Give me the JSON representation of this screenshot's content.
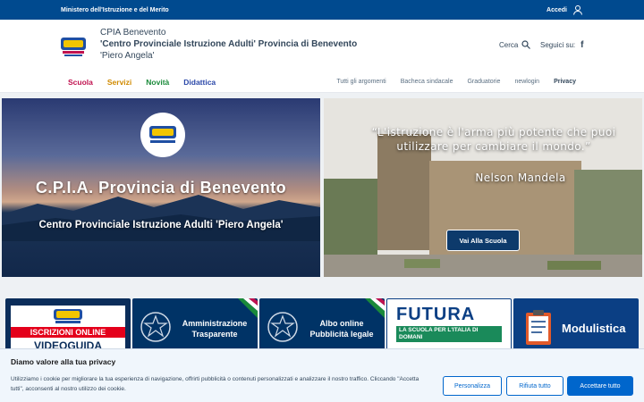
{
  "topbar": {
    "ministry": "Ministero dell'Istruzione e del Merito",
    "login_label": "Accedi",
    "login_icon": "user-icon"
  },
  "header": {
    "school_line1": "CPIA Benevento",
    "school_line2": "'Centro Provinciale Istruzione Adulti' Provincia di Benevento",
    "school_line3": "'Piero Angela'",
    "search_label": "Cerca",
    "follow_label": "Seguici su:",
    "social": "f"
  },
  "nav": {
    "main": [
      {
        "label": "Scuola",
        "color": "#c0124f"
      },
      {
        "label": "Servizi",
        "color": "#d08a00"
      },
      {
        "label": "Novità",
        "color": "#1a8a3a"
      },
      {
        "label": "Didattica",
        "color": "#2a47a8"
      }
    ],
    "secondary": [
      "Tutti gli argomenti",
      "Bacheca sindacale",
      "Graduatorie",
      "newlogin",
      "Privacy"
    ]
  },
  "hero": {
    "left_title": "C.P.I.A. Provincia di Benevento",
    "left_subtitle": "Centro Provinciale Istruzione Adulti 'Piero Angela'",
    "quote": "“L'istruzione è l'arma più potente che puoi utilizzare per cambiare il mondo.”",
    "author": "Nelson Mandela",
    "button": "Vai Alla Scuola"
  },
  "tiles": {
    "t1_banner": "ISCRIZIONI ONLINE",
    "t1_title": "VIDEOGUIDA",
    "t2_line1": "Amministrazione",
    "t2_line2": "Trasparente",
    "t3_line1": "Albo online",
    "t3_line2": "Pubblicità legale",
    "t4_title": "FUTURA",
    "t4_sub": "LA SCUOLA PER L'ITALIA DI DOMANI",
    "t5_title": "Modulistica"
  },
  "cookie": {
    "title": "Diamo valore alla tua privacy",
    "text": "Utilizziamo i cookie per migliorare la tua esperienza di navigazione, offrirti pubblicità o contenuti personalizzati e analizzare il nostro traffico. Cliccando \"Accetta tutti\", acconsenti al nostro utilizzo dei cookie.",
    "btn_customize": "Personalizza",
    "btn_reject": "Rifiuta tutto",
    "btn_accept": "Accettare tutto"
  }
}
